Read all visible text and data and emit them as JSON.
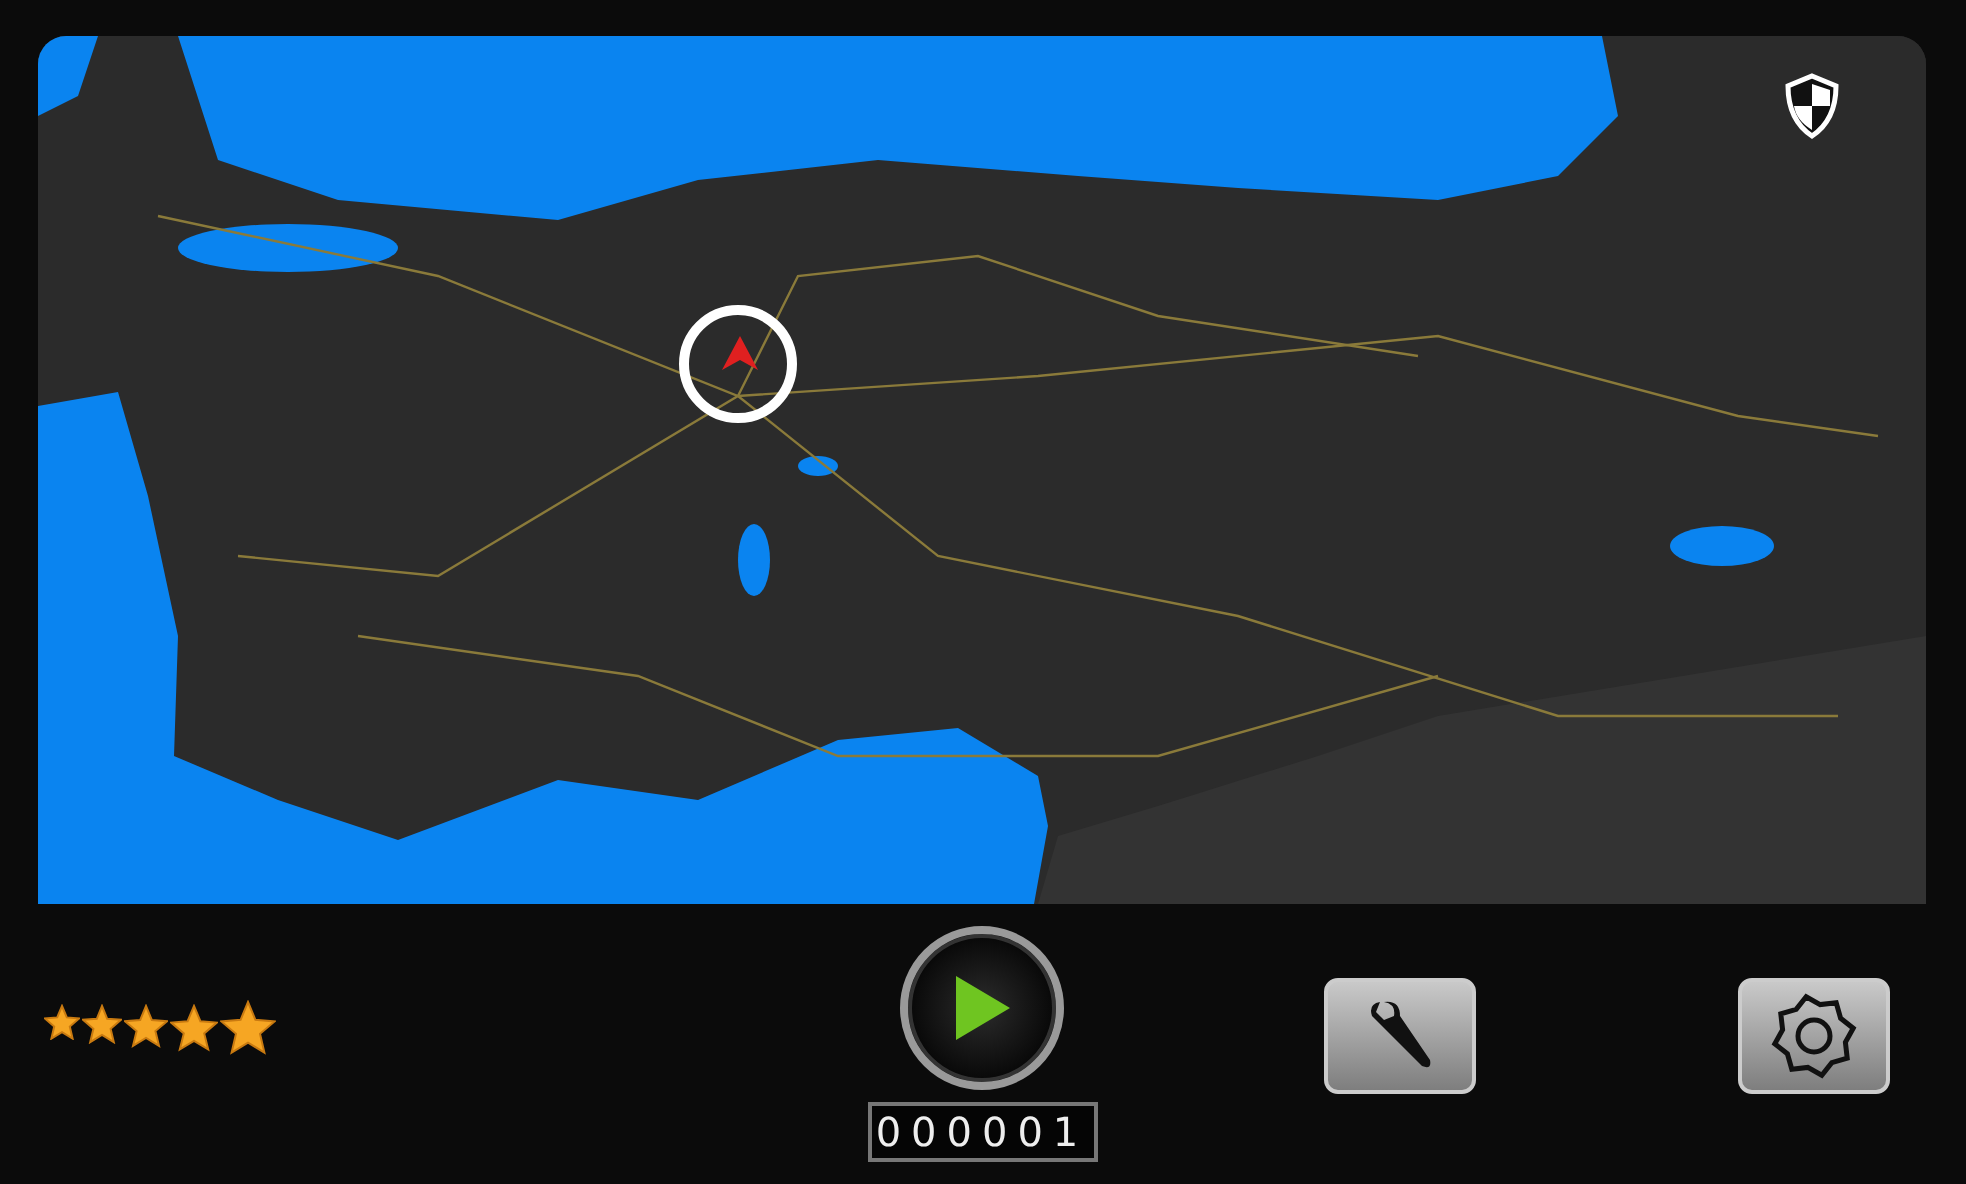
{
  "rating": {
    "stars": 5
  },
  "counter": {
    "value": "000001"
  }
}
